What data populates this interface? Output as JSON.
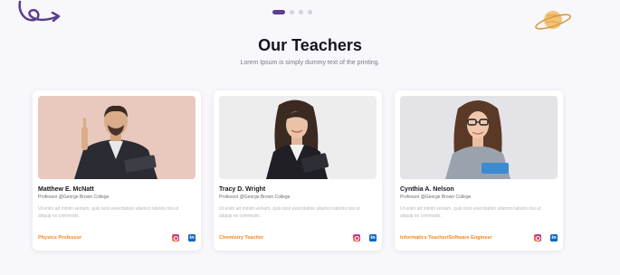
{
  "header": {
    "title": "Our Teachers",
    "subtitle": "Lorem Ipsum is simply dummy text of the printing."
  },
  "pager": {
    "count": 4,
    "active_index": 0
  },
  "colors": {
    "accent": "#5a3f8e",
    "subject": "#f0861f",
    "linkedin": "#0a66c2"
  },
  "teachers": [
    {
      "name": "Matthew E. McNatt",
      "role": "Professor @George Brown College",
      "bio": "Ut enim ad minim veniam, quis nost exercitation ullamco laboris nisi ut aliquip ex commodo.",
      "subject": "Physics Professor",
      "social": [
        "instagram-icon",
        "linkedin-icon"
      ]
    },
    {
      "name": "Tracy D. Wright",
      "role": "Professor @George Brown College",
      "bio": "Ut enim ad minim veniam, quis nost exercitation ullamco laboris nisi ut aliquip ex commodo.",
      "subject": "Chemistry Teacher",
      "social": [
        "instagram-icon",
        "linkedin-icon"
      ]
    },
    {
      "name": "Cynthia A. Nelson",
      "role": "Professor @George Brown College",
      "bio": "Ut enim ad minim veniam, quis nost exercitation ullamco laboris nisi ut aliquip ex commodo.",
      "subject": "Informatics Teacher/Software Engineer",
      "social": [
        "instagram-icon",
        "linkedin-icon"
      ]
    }
  ],
  "social_labels": {
    "linkedin": "in"
  }
}
